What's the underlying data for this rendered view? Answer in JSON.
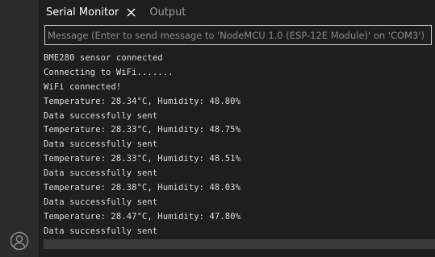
{
  "tabs": [
    {
      "label": "Serial Monitor"
    },
    {
      "label": "Output"
    }
  ],
  "message_input": {
    "placeholder": "Message (Enter to send message to 'NodeMCU 1.0 (ESP-12E Module)' on 'COM3')",
    "value": ""
  },
  "console": {
    "lines": [
      "BME280 sensor connected",
      "Connecting to WiFi.......",
      "WiFi connected!",
      "Temperature: 28.34°C, Humidity: 48.80%",
      "Data successfully sent",
      "Temperature: 28.33°C, Humidity: 48.75%",
      "Data successfully sent",
      "Temperature: 28.33°C, Humidity: 48.51%",
      "Data successfully sent",
      "Temperature: 28.38°C, Humidity: 48.03%",
      "Data successfully sent",
      "Temperature: 28.47°C, Humidity: 47.80%",
      "Data successfully sent"
    ]
  },
  "icons": {
    "tab_close": "close-icon",
    "account": "account-icon"
  },
  "colors": {
    "background": "#1e1e1e",
    "activity_bar": "#2c2c2c",
    "text": "#dcdcdc",
    "active_tab": "#ffffff",
    "inactive_tab": "#9d9d9d",
    "input_border": "#cccccc",
    "scrollbar": "#3a3a3a"
  }
}
